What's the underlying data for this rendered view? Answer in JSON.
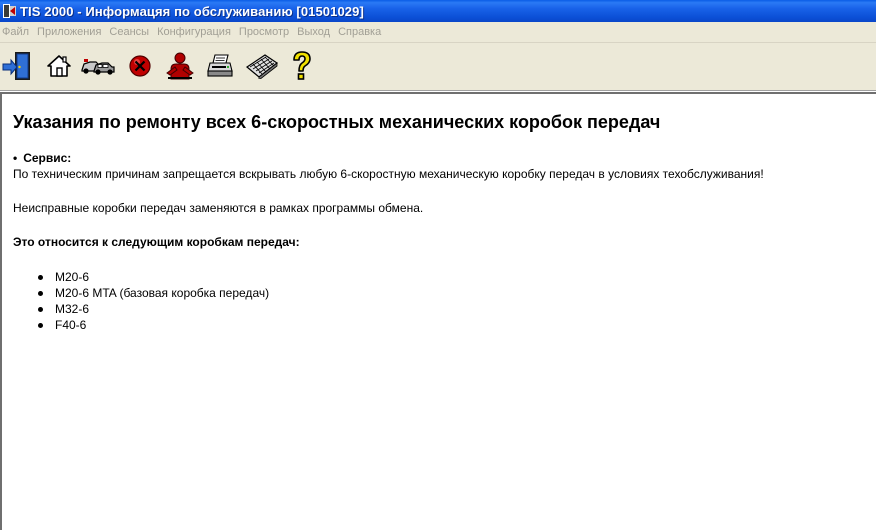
{
  "window": {
    "title": "TIS 2000 - Информацяя по обслуживанию [01501029]"
  },
  "menu": {
    "items": [
      "Файл",
      "Приложения",
      "Сеансы",
      "Конфигурация",
      "Просмотр",
      "Выход",
      "Справка"
    ]
  },
  "toolbar": {
    "buttons": [
      {
        "icon": "exit-door-icon"
      },
      {
        "icon": "home-icon"
      },
      {
        "icon": "cars-icon"
      },
      {
        "icon": "stop-icon",
        "color": "#c00000"
      },
      {
        "icon": "person-icon",
        "color": "#b00000"
      },
      {
        "icon": "printer-icon"
      },
      {
        "icon": "keyboard-icon"
      },
      {
        "icon": "help-question-icon",
        "color": "#f0e000"
      }
    ]
  },
  "document": {
    "title": "Указания по ремонту всех 6-скоростных механических коробок передач",
    "service_bullet": "•",
    "service_label": "Сервис:",
    "paragraph1": "По техническим причинам запрещается вскрывать любую 6-скоростную механическую коробку передач в условиях техобслуживания!",
    "paragraph2": "Неисправные коробки передач заменяются в рамках программы обмена.",
    "paragraph3": "Это относится к следующим коробкам передач:",
    "models": [
      "M20-6",
      "M20-6 MTA (базовая коробка передач)",
      "M32-6",
      "F40-6"
    ]
  }
}
